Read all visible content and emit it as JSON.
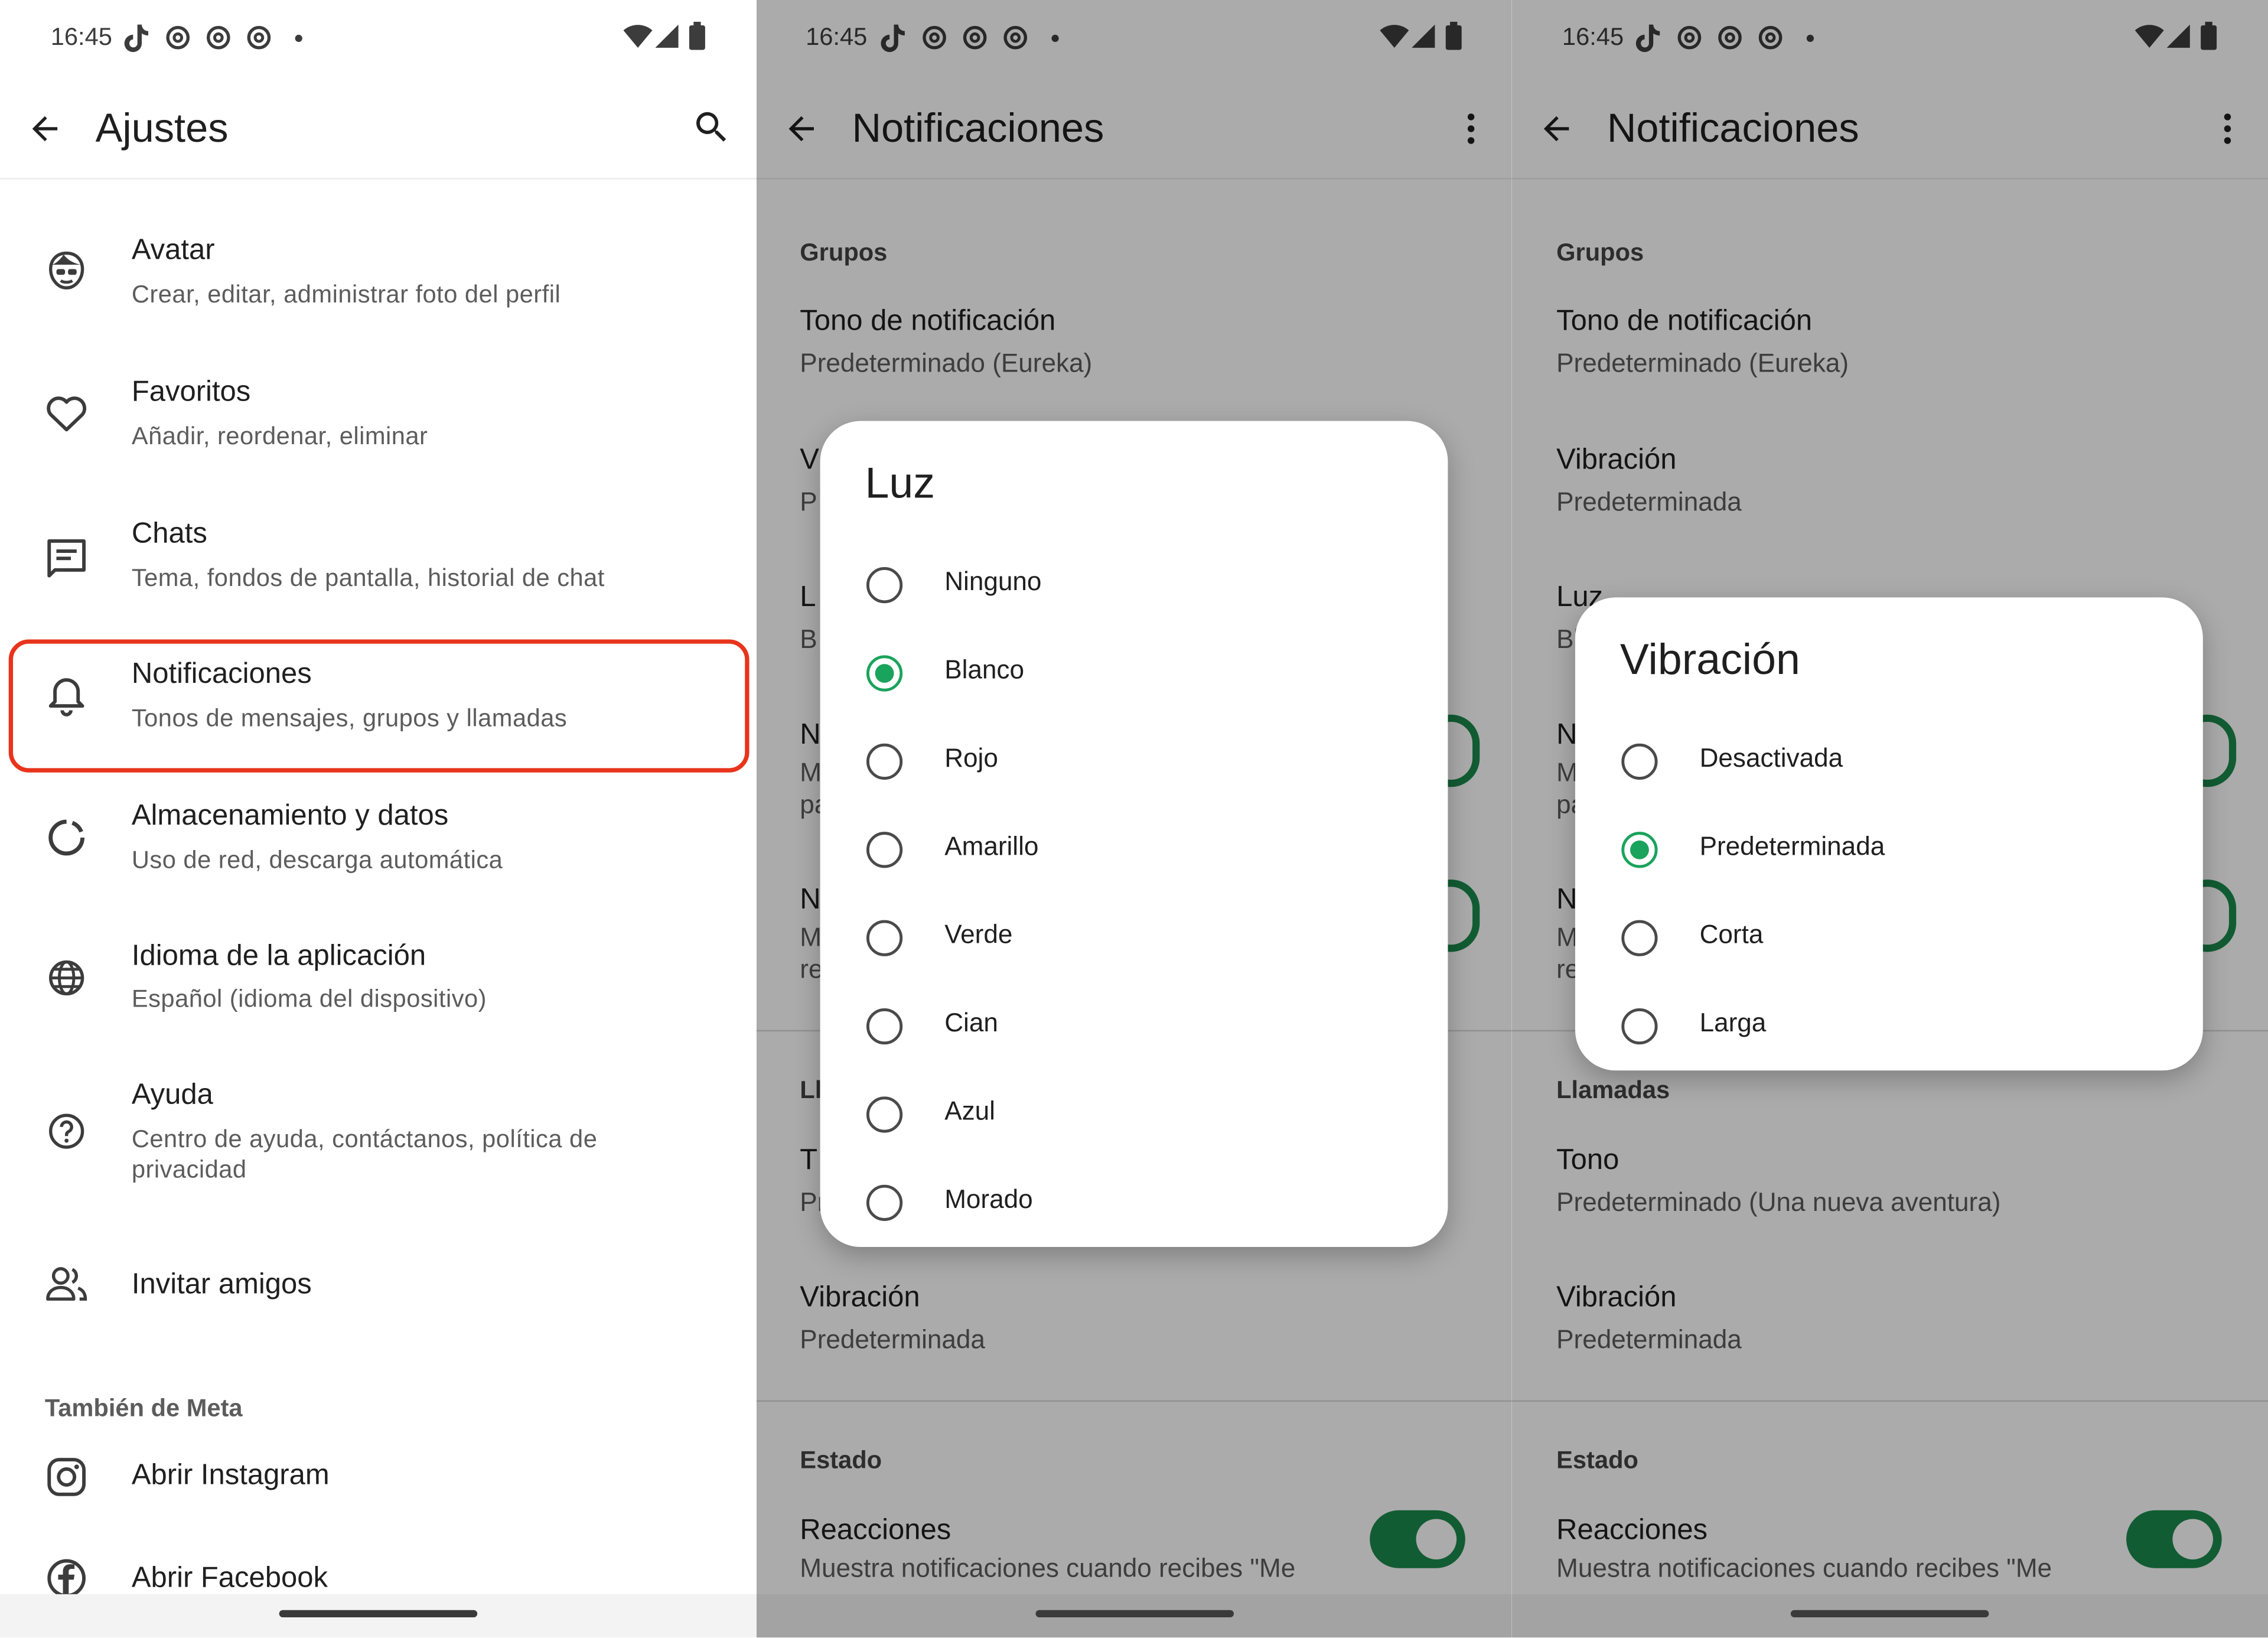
{
  "status_bar": {
    "time": "16:45"
  },
  "screen1": {
    "title": "Ajustes",
    "items": [
      {
        "title": "Avatar",
        "subtitle": "Crear, editar, administrar foto del perfil"
      },
      {
        "title": "Favoritos",
        "subtitle": "Añadir, reordenar, eliminar"
      },
      {
        "title": "Chats",
        "subtitle": "Tema, fondos de pantalla, historial de chat"
      },
      {
        "title": "Notificaciones",
        "subtitle": "Tonos de mensajes, grupos y llamadas"
      },
      {
        "title": "Almacenamiento y datos",
        "subtitle": "Uso de red, descarga automática"
      },
      {
        "title": "Idioma de la aplicación",
        "subtitle": "Español (idioma del dispositivo)"
      },
      {
        "title": "Ayuda",
        "subtitle": "Centro de ayuda, contáctanos, política de",
        "subtitle2": "privacidad"
      },
      {
        "title": "Invitar amigos"
      }
    ],
    "meta_section": "También de Meta",
    "meta_items": [
      {
        "title": "Abrir Instagram"
      },
      {
        "title": "Abrir Facebook"
      }
    ],
    "highlight_color": "#e8341c"
  },
  "notif": {
    "title": "Notificaciones",
    "groups_header": "Grupos",
    "tone_title": "Tono de notificación",
    "tone_value": "Predeterminado (Eureka)",
    "vibration_title": "Vibración",
    "vibration_value": "Predeterminada",
    "light_title": "Luz",
    "calls_header": "Llamadas",
    "call_tone_title": "Tono",
    "call_tone_value": "Predeterminado (Una nueva aventura)",
    "call_vibration_title": "Vibración",
    "call_vibration_value": "Predeterminada",
    "status_header": "Estado",
    "reactions_title": "Reacciones",
    "reactions_sub": "Muestra notificaciones cuando recibes \"Me",
    "partial": {
      "v": "V",
      "p": "P",
      "l": "L",
      "b": "B",
      "n": "N",
      "m": "M",
      "pa": "pa",
      "re": "re",
      "ll": "Ll",
      "t": "T",
      "pr": "Pr",
      "lu": "Luz",
      "bl": "Bl"
    },
    "accent_color": "#1b8a4c"
  },
  "light_dialog": {
    "title": "Luz",
    "selected": "Blanco",
    "options": [
      "Ninguno",
      "Blanco",
      "Rojo",
      "Amarillo",
      "Verde",
      "Cian",
      "Azul",
      "Morado"
    ]
  },
  "vibration_dialog": {
    "title": "Vibración",
    "selected": "Predeterminada",
    "options": [
      "Desactivada",
      "Predeterminada",
      "Corta",
      "Larga"
    ]
  },
  "icons": {
    "status": [
      "tiktok-icon",
      "threads-icon",
      "wifi-icon",
      "signal-icon",
      "battery-icon"
    ],
    "screen1": [
      "back-arrow-icon",
      "search-icon",
      "avatar-face-icon",
      "heart-icon",
      "chat-icon",
      "bell-icon",
      "storage-icon",
      "globe-icon",
      "help-icon",
      "people-icon",
      "instagram-icon",
      "facebook-icon"
    ],
    "notif": [
      "back-arrow-icon",
      "more-vert-icon"
    ]
  }
}
